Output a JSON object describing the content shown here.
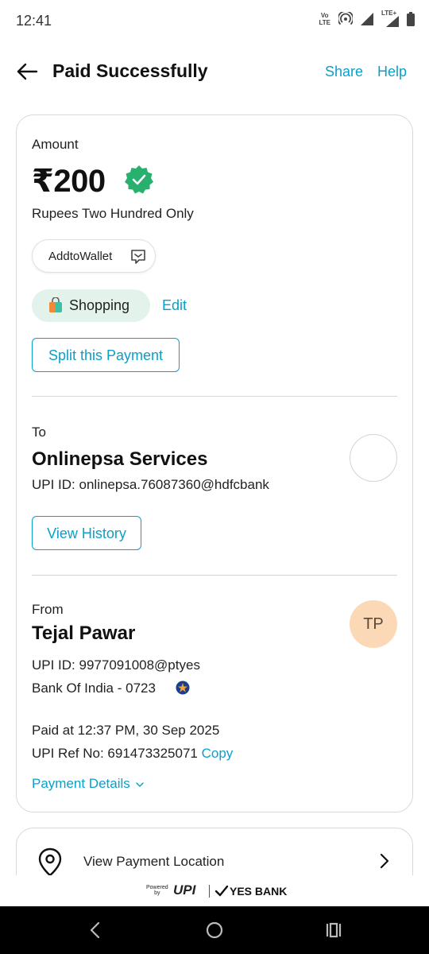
{
  "status_bar": {
    "time": "12:41",
    "volte_top": "Vo",
    "volte_bottom": "LTE",
    "lte_label": "LTE+"
  },
  "header": {
    "title": "Paid Successfully",
    "share": "Share",
    "help": "Help"
  },
  "amount": {
    "label": "Amount",
    "value": "₹200",
    "words": "Rupees Two Hundred Only",
    "wallet_chip": "AddtoWallet",
    "category": "Shopping",
    "edit": "Edit",
    "split_button": "Split this Payment"
  },
  "to": {
    "label": "To",
    "name": "Onlinepsa Services",
    "upi_id": "UPI ID: onlinepsa.76087360@hdfcbank",
    "history_button": "View History"
  },
  "from": {
    "label": "From",
    "name": "Tejal Pawar",
    "initials": "TP",
    "upi_id": "UPI ID: 9977091008@ptyes",
    "bank": "Bank Of India - 0723",
    "paid_at": "Paid at 12:37 PM, 30 Sep 2025",
    "ref_label": "UPI Ref No: 691473325071",
    "copy": "Copy",
    "details_link": "Payment Details"
  },
  "location": {
    "label": "View Payment Location"
  },
  "footer": {
    "powered_line1": "Powered",
    "powered_line2": "by",
    "upi": "UPI",
    "bank": "YES BANK"
  },
  "colors": {
    "accent": "#0aa0c8",
    "verified": "#27b06e",
    "category_bg": "#e3f3ec",
    "avatar_bg": "#fbd9b6"
  },
  "icons": [
    "back-arrow-icon",
    "verified-badge-icon",
    "message-icon",
    "shopping-bag-icon",
    "bank-logo-icon",
    "chevron-down-icon",
    "location-pin-icon",
    "chevron-right-icon"
  ]
}
